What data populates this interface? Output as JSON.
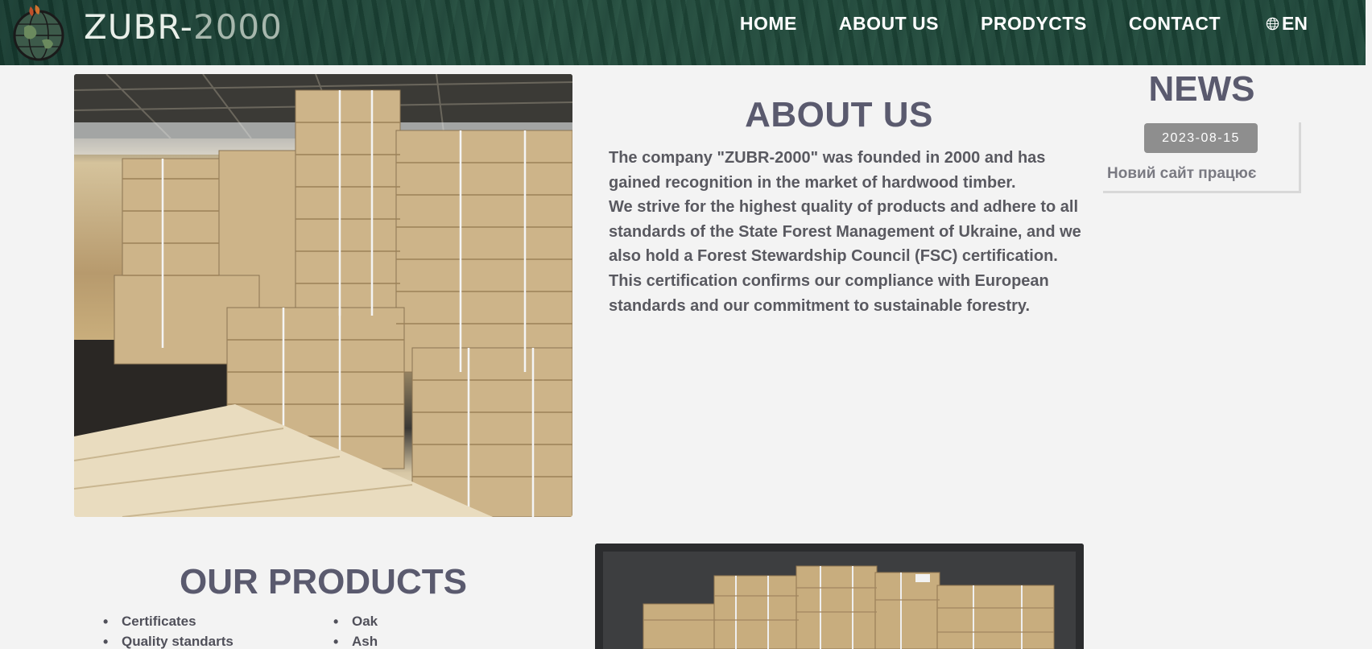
{
  "header": {
    "brand": "ZUBR-",
    "brand_suffix": "2000",
    "nav": [
      {
        "label": "HOME"
      },
      {
        "label": "ABOUT US"
      },
      {
        "label": "PRODYCTS"
      },
      {
        "label": "CONTACT"
      }
    ],
    "language": "EN",
    "language_icon": "globe-icon"
  },
  "about": {
    "title": "ABOUT US",
    "paragraphs": [
      "The company \"ZUBR-2000\" was founded in 2000 and has gained recognition in the market of hardwood timber.",
      "We strive for the highest quality of products and adhere to all standards of the State Forest Management of Ukraine, and we also hold a Forest Stewardship Council (FSC) certification.",
      "This certification confirms our compliance with European standards and our commitment to sustainable forestry."
    ]
  },
  "news": {
    "title": "NEWS",
    "items": [
      {
        "date": "2023-08-15",
        "text": "Новий сайт працює"
      }
    ]
  },
  "products": {
    "title": "OUR PRODUCTS",
    "left_list": [
      "Certificates",
      "Quality standarts"
    ],
    "right_list": [
      "Oak",
      "Ash"
    ]
  },
  "colors": {
    "heading": "#5a5a6e",
    "news_date_bg": "#8e8e8e",
    "header_green": "#2c5c4b"
  }
}
